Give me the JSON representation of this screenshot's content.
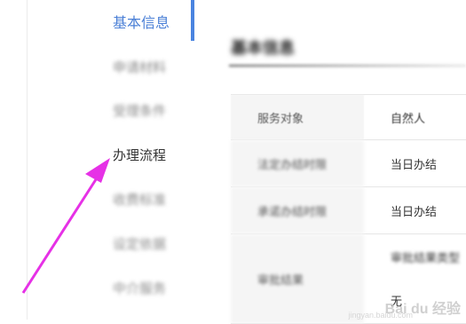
{
  "sidebar": {
    "items": [
      {
        "label": "基本信息"
      },
      {
        "label": "申请材料"
      },
      {
        "label": "受理条件"
      },
      {
        "label": "办理流程"
      },
      {
        "label": "收费标准"
      },
      {
        "label": "设定依据"
      },
      {
        "label": "中介服务"
      }
    ]
  },
  "content": {
    "section_title": "基本信息",
    "rows": [
      {
        "label": "服务对象",
        "value": "自然人"
      },
      {
        "label": "法定办结时限",
        "value": "当日办结"
      },
      {
        "label": "承诺办结时限",
        "value": "当日办结"
      },
      {
        "label": "审批结果",
        "value": "审批结果类型",
        "value2": "无"
      }
    ]
  },
  "watermark": {
    "text": "Bai du 经验",
    "sub": "jingyan.baidu.com"
  },
  "colors": {
    "active": "#4a7fd6",
    "arrow": "#e631e6"
  }
}
